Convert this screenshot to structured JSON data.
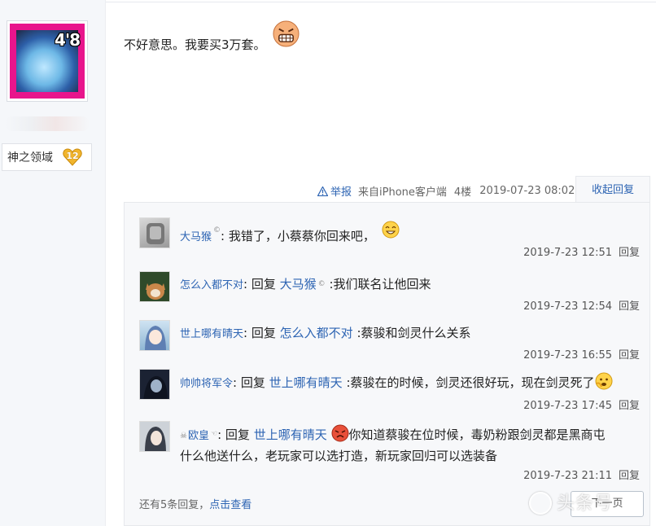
{
  "author": {
    "avatar_badge": "4'8",
    "level_name": "神之领域",
    "level_number": "12"
  },
  "post": {
    "content": "不好意思。我要买3万套。",
    "emoji": "grinning-face-emoji"
  },
  "post_meta": {
    "report": "举报",
    "source": "来自iPhone客户端",
    "floor": "4楼",
    "date": "2019-07-23 08:02",
    "collapse_label": "收起回复"
  },
  "replies": [
    {
      "user": "大马猴",
      "user_tag": "©",
      "sep": ":",
      "text": "我错了，小蔡蔡你回来吧，",
      "date": "2019-7-23 12:51",
      "reply_label": "回复"
    },
    {
      "user": "怎么入都不对",
      "sep": ":",
      "reply_word": "回复",
      "target": "大马猴",
      "target_tag": "©",
      "text": ":我们联名让他回来",
      "date": "2019-7-23 12:54",
      "reply_label": "回复"
    },
    {
      "user": "世上哪有晴天",
      "sep": ":",
      "reply_word": "回复",
      "target": "怎么入都不对",
      "text": ":蔡骏和剑灵什么关系",
      "date": "2019-7-23 16:55",
      "reply_label": "回复"
    },
    {
      "user": "帅帅将军令",
      "sep": ":",
      "reply_word": "回复",
      "target": "世上哪有晴天",
      "text": ":蔡骏在的时候，剑灵还很好玩，现在剑灵死了",
      "date": "2019-7-23 17:45",
      "reply_label": "回复"
    },
    {
      "user": "欧皇",
      "user_tag": "☜",
      "sep": ":",
      "reply_word": "回复",
      "target": "世上哪有晴天",
      "text_line1": "你知道蔡骏在位时候，毒奶粉跟剑灵都是黑商屯",
      "text_line2": "什么他送什么，老玩家可以选打造，新玩家回归可以选装备",
      "date": "2019-7-23 21:11",
      "reply_label": "回复"
    }
  ],
  "more": {
    "prefix": "还有5条回复，",
    "link": "点击查看"
  },
  "pager": {
    "next_label": "下一页"
  },
  "watermark": "头条号"
}
